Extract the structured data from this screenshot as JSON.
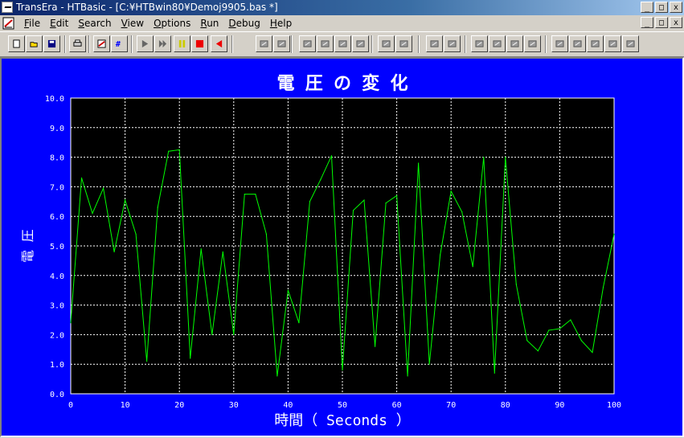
{
  "window": {
    "title": "TransEra - HTBasic - [C:¥HTBwin80¥Demoj9905.bas *]",
    "min_glyph": "_",
    "max_glyph": "□",
    "close_glyph": "x"
  },
  "menu": {
    "items": [
      {
        "hot": "F",
        "rest": "ile"
      },
      {
        "hot": "E",
        "rest": "dit"
      },
      {
        "hot": "S",
        "rest": "earch"
      },
      {
        "hot": "V",
        "rest": "iew"
      },
      {
        "hot": "O",
        "rest": "ptions"
      },
      {
        "hot": "R",
        "rest": "un"
      },
      {
        "hot": "D",
        "rest": "ebug"
      },
      {
        "hot": "H",
        "rest": "elp"
      }
    ]
  },
  "toolbar": {
    "icons": [
      "new-file-icon",
      "open-folder-icon",
      "save-disk-icon",
      "print-icon",
      "edit-program-icon",
      "line-numbers-icon",
      "run-icon",
      "continue-icon",
      "pause-icon",
      "stop-icon",
      "step-back-icon",
      "find-icon",
      "replace-icon",
      "bookmark-icon",
      "bookmark-next-icon",
      "bookmark-prev-icon",
      "bookmark-clear-icon",
      "comment-icon",
      "uncomment-icon",
      "wrench-icon",
      "wrench-multi-icon",
      "hand-icon",
      "hand-all-icon",
      "hand-break-icon",
      "hand-clear-icon",
      "watch-icon",
      "watch-edit-icon",
      "watch-step-icon",
      "step-into-icon",
      "step-over-icon"
    ]
  },
  "accent": "#0000ff",
  "chart_data": {
    "type": "line",
    "title": "電 圧 の 変 化",
    "xlabel": "時間（ Seconds ）",
    "ylabel": "電 圧",
    "xlim": [
      0,
      100
    ],
    "ylim": [
      0,
      10
    ],
    "grid": true,
    "xticks": [
      "0",
      "10",
      "20",
      "30",
      "40",
      "50",
      "60",
      "70",
      "80",
      "90",
      "100"
    ],
    "yticks": [
      "0.0",
      "1.0",
      "2.0",
      "3.0",
      "4.0",
      "5.0",
      "6.0",
      "7.0",
      "8.0",
      "9.0",
      "10.0"
    ],
    "line_color": "#00ff00",
    "series": [
      {
        "x": [
          0,
          2,
          4,
          6,
          8,
          10,
          12,
          14,
          16,
          18,
          20,
          22,
          24,
          26,
          28,
          30,
          32,
          34,
          36,
          38,
          40,
          42,
          44,
          46,
          48,
          50,
          52,
          54,
          56,
          58,
          60,
          62,
          64,
          66,
          68,
          70,
          72,
          74,
          76,
          78,
          80,
          82,
          84,
          86,
          88,
          90,
          92,
          94,
          96,
          98,
          100
        ],
        "values": [
          2.4,
          7.3,
          6.1,
          6.95,
          4.8,
          6.55,
          5.4,
          1.1,
          6.3,
          8.2,
          8.25,
          1.2,
          4.9,
          2.0,
          4.8,
          2.0,
          6.75,
          6.75,
          5.4,
          0.6,
          3.5,
          2.4,
          6.5,
          7.25,
          8.05,
          0.8,
          6.2,
          6.55,
          1.6,
          6.45,
          6.7,
          0.6,
          7.8,
          1.0,
          4.7,
          6.85,
          6.15,
          4.3,
          8.0,
          0.7,
          8.0,
          3.7,
          1.8,
          1.45,
          2.15,
          2.2,
          2.5,
          1.8,
          1.4,
          3.6,
          5.4
        ]
      }
    ]
  }
}
